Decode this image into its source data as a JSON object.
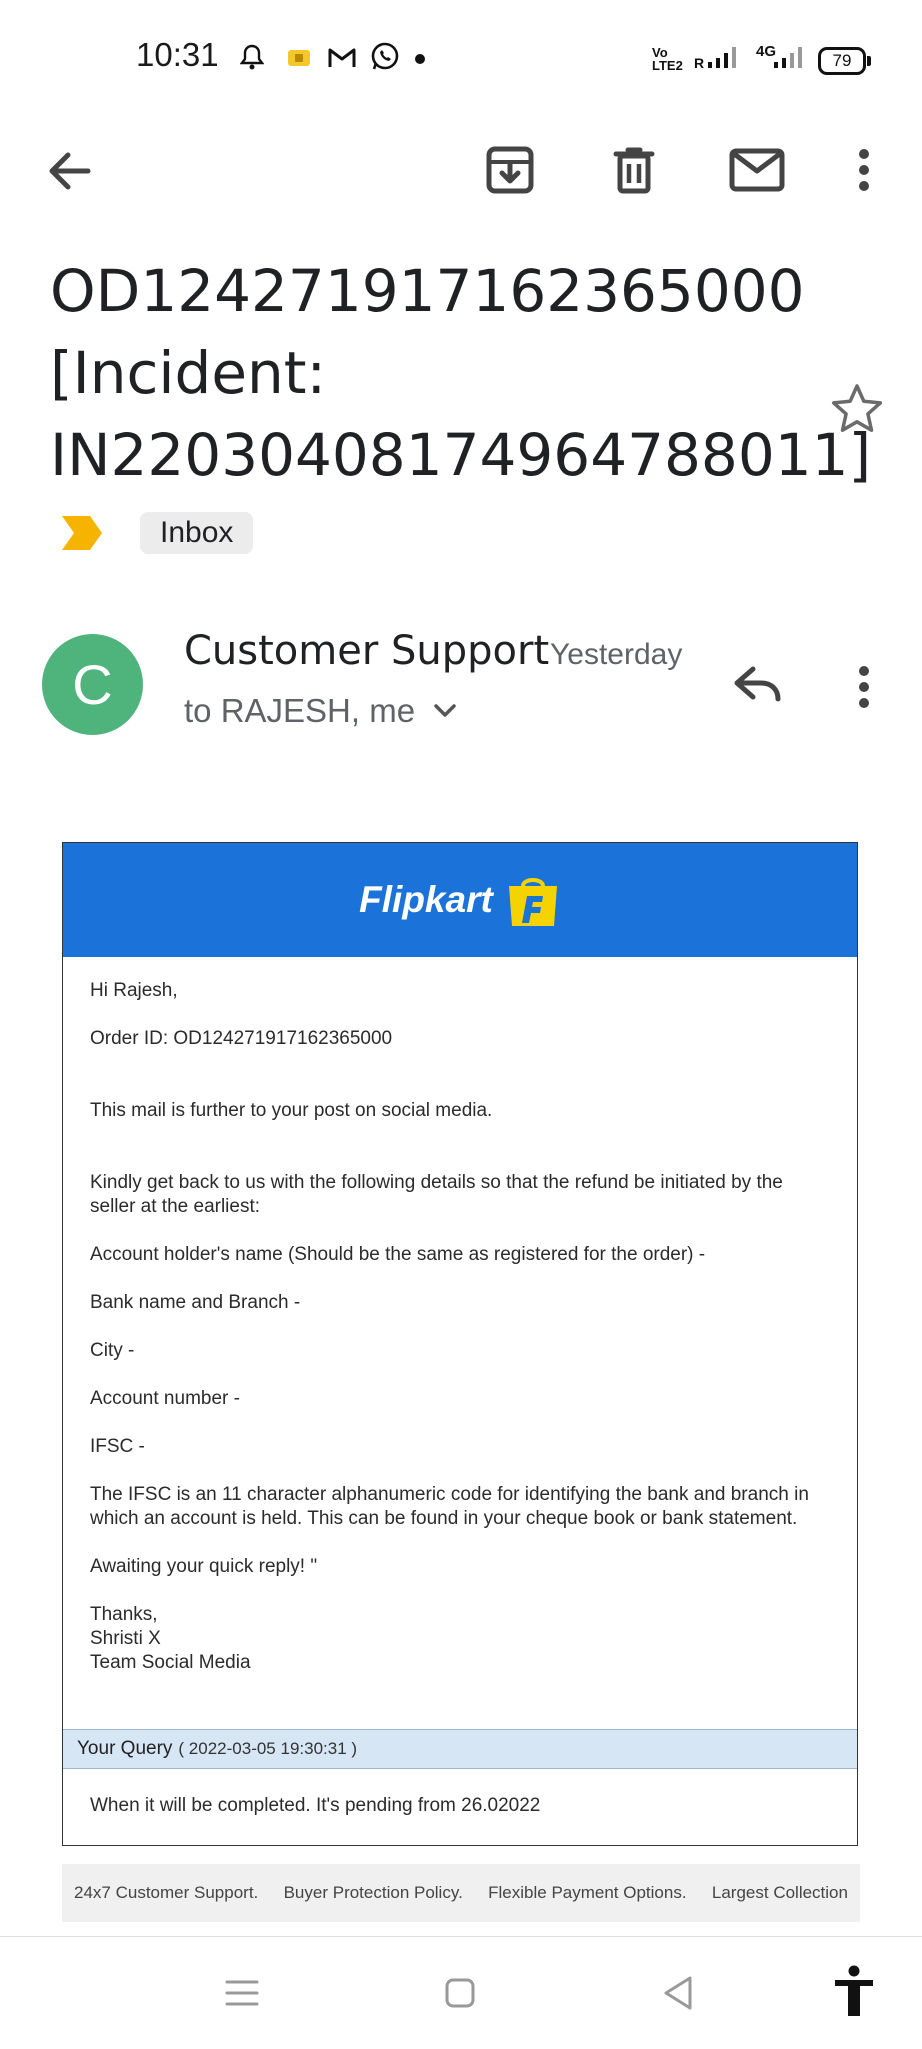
{
  "status_bar": {
    "time": "10:31",
    "network_1": "Vo LTE2",
    "network_2": "R",
    "network_3": "4G",
    "battery": "79"
  },
  "subject": "OD124271917162365000 [Incident: IN22030408174964788011]",
  "label": "Inbox",
  "sender": {
    "avatar_letter": "C",
    "name": "Customer Support",
    "time": "Yesterday",
    "to": "to RAJESH, me"
  },
  "email": {
    "brand": "Flipkart",
    "greeting": "Hi Rajesh,",
    "order_id": "Order ID: OD124271917162365000",
    "para1": "This mail is further to your post on social media.",
    "para2": "Kindly get back to us with the following details so that the refund be initiated by the seller at the earliest:",
    "field_name": "Account holder's name (Should be the same as registered for the order) -",
    "field_bank": "Bank name and Branch -",
    "field_city": "City -",
    "field_account": "Account number -",
    "field_ifsc": "IFSC -",
    "ifsc_note": "The IFSC is an 11 character alphanumeric code for identifying the bank and branch in which an account is held. This can be found in your cheque book or bank statement.",
    "awaiting": "Awaiting your quick reply! \"",
    "sign_thanks": "Thanks,",
    "sign_name": "Shristi X",
    "sign_team": "Team Social Media",
    "query_label": "Your Query",
    "query_timestamp": "( 2022-03-05 19:30:31 )",
    "query_text": "When it will be completed. It's pending from 26.02022"
  },
  "footer": [
    "24x7 Customer Support.",
    "Buyer Protection Policy.",
    "Flexible Payment Options.",
    "Largest Collection"
  ],
  "colors": {
    "avatar": "#4fb47c",
    "banner": "#1b72d8",
    "importance_marker": "#f6b400",
    "query_bar": "#d6e6f5"
  }
}
